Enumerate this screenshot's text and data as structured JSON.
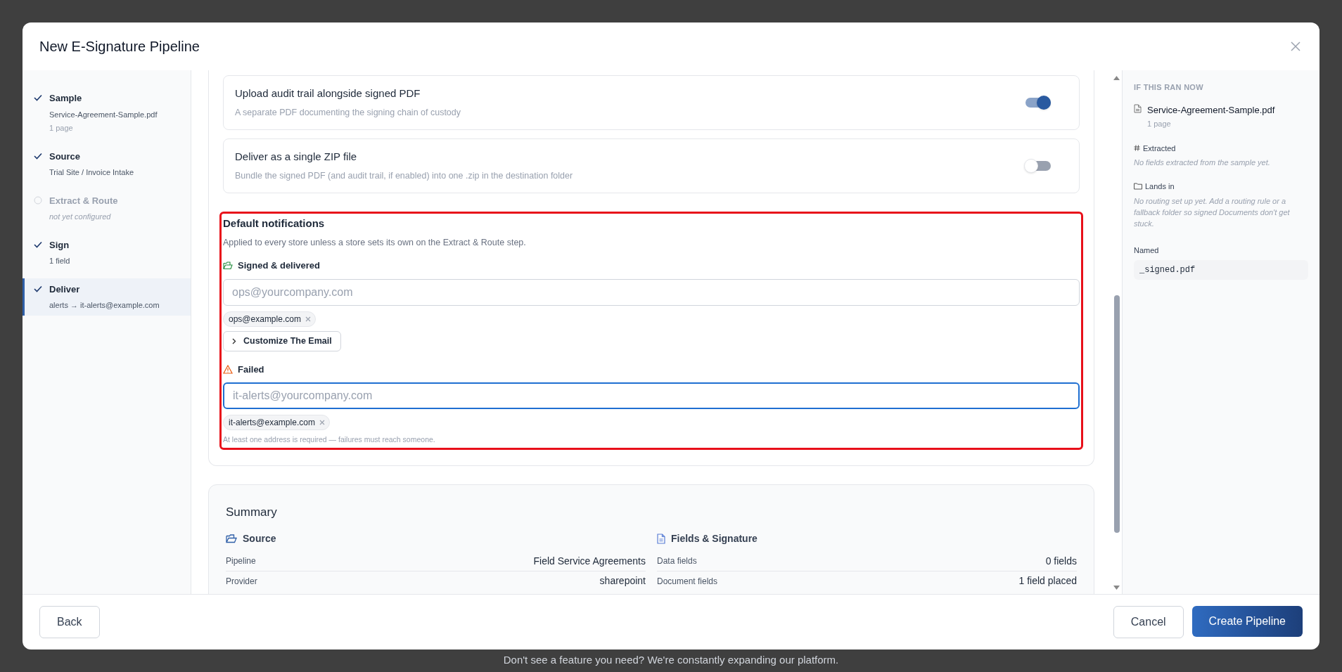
{
  "backdrop": {
    "footer_text": "Don't see a feature you need? We're constantly expanding our platform."
  },
  "dialog": {
    "title": "New E-Signature Pipeline"
  },
  "steps": [
    {
      "label": "Sample",
      "subtitle": "Service-Agreement-Sample.pdf",
      "note": "1 page",
      "done": true,
      "selected": false
    },
    {
      "label": "Source",
      "subtitle": "Trial Site / Invoice Intake",
      "done": true,
      "selected": false
    },
    {
      "label": "Extract & Route",
      "subtitle": "not yet configured",
      "done": false,
      "selected": false
    },
    {
      "label": "Sign",
      "subtitle": "1 field",
      "done": true,
      "selected": false
    },
    {
      "label": "Deliver",
      "subtitle": "alerts → it-alerts@example.com",
      "done": true,
      "selected": true
    }
  ],
  "options": [
    {
      "title": "Upload audit trail alongside signed PDF",
      "description": "A separate PDF documenting the signing chain of custody",
      "on": true
    },
    {
      "title": "Deliver as a single ZIP file",
      "description": "Bundle the signed PDF (and audit trail, if enabled) into one .zip in the destination folder",
      "on": false
    }
  ],
  "notifications": {
    "title": "Default notifications",
    "description": "Applied to every store unless a store sets its own on the Extract & Route step.",
    "groups": [
      {
        "kind": "success",
        "label": "Signed & delivered",
        "placeholder": "ops@yourcompany.com",
        "focused": false,
        "chips": [
          "ops@example.com"
        ],
        "customize_button": "Customize The Email"
      },
      {
        "kind": "failure",
        "label": "Failed",
        "placeholder": "it-alerts@yourcompany.com",
        "focused": true,
        "chips": [
          "it-alerts@example.com"
        ],
        "hint": "At least one address is required — failures must reach someone."
      }
    ]
  },
  "summary": {
    "title": "Summary",
    "columns": [
      {
        "kind": "source",
        "title": "Source",
        "rows": [
          {
            "label": "Pipeline",
            "value": "Field Service Agreements"
          },
          {
            "label": "Provider",
            "value": "sharepoint"
          }
        ]
      },
      {
        "kind": "fields",
        "title": "Fields & Signature",
        "rows": [
          {
            "label": "Data fields",
            "value": "0 fields"
          },
          {
            "label": "Document fields",
            "value": "1 field placed"
          }
        ]
      }
    ]
  },
  "preview": {
    "heading": "IF THIS RAN NOW",
    "file": {
      "name": "Service-Agreement-Sample.pdf",
      "pages": "1 page"
    },
    "sections": [
      {
        "kind": "extracted",
        "title": "Extracted",
        "text": "No fields extracted from the sample yet."
      },
      {
        "kind": "lands",
        "title": "Lands in",
        "text": "No routing set up yet. Add a routing rule or a fallback folder so signed Documents don't get stuck."
      }
    ],
    "named": {
      "label": "Named",
      "value": "_signed.pdf"
    }
  },
  "footer": {
    "back": "Back",
    "cancel": "Cancel",
    "create": "Create Pipeline"
  }
}
